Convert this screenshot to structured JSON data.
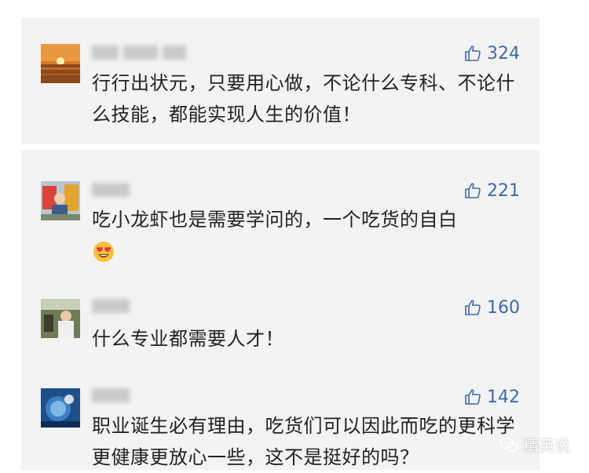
{
  "colors": {
    "card_bg": "#f3f3f3",
    "like_blue": "#3e6aa3",
    "text": "#222222"
  },
  "comments": [
    {
      "likes": "324",
      "text": "行行出状元，只要用心做，不论什么专科、不论什么技能，都能实现人生的价值！"
    },
    {
      "likes": "221",
      "text": "吃小龙虾也是需要学问的，一个吃货的自白",
      "emoji": "heart-eyes-emoji"
    },
    {
      "likes": "160",
      "text": "什么专业都需要人才！"
    },
    {
      "likes": "142",
      "text": "职业诞生必有理由，吃货们可以因此而吃的更科学更健康更放心一些，这不是挺好的吗？"
    }
  ],
  "watermark": {
    "text": "精英说",
    "icon": "wechat-icon"
  }
}
